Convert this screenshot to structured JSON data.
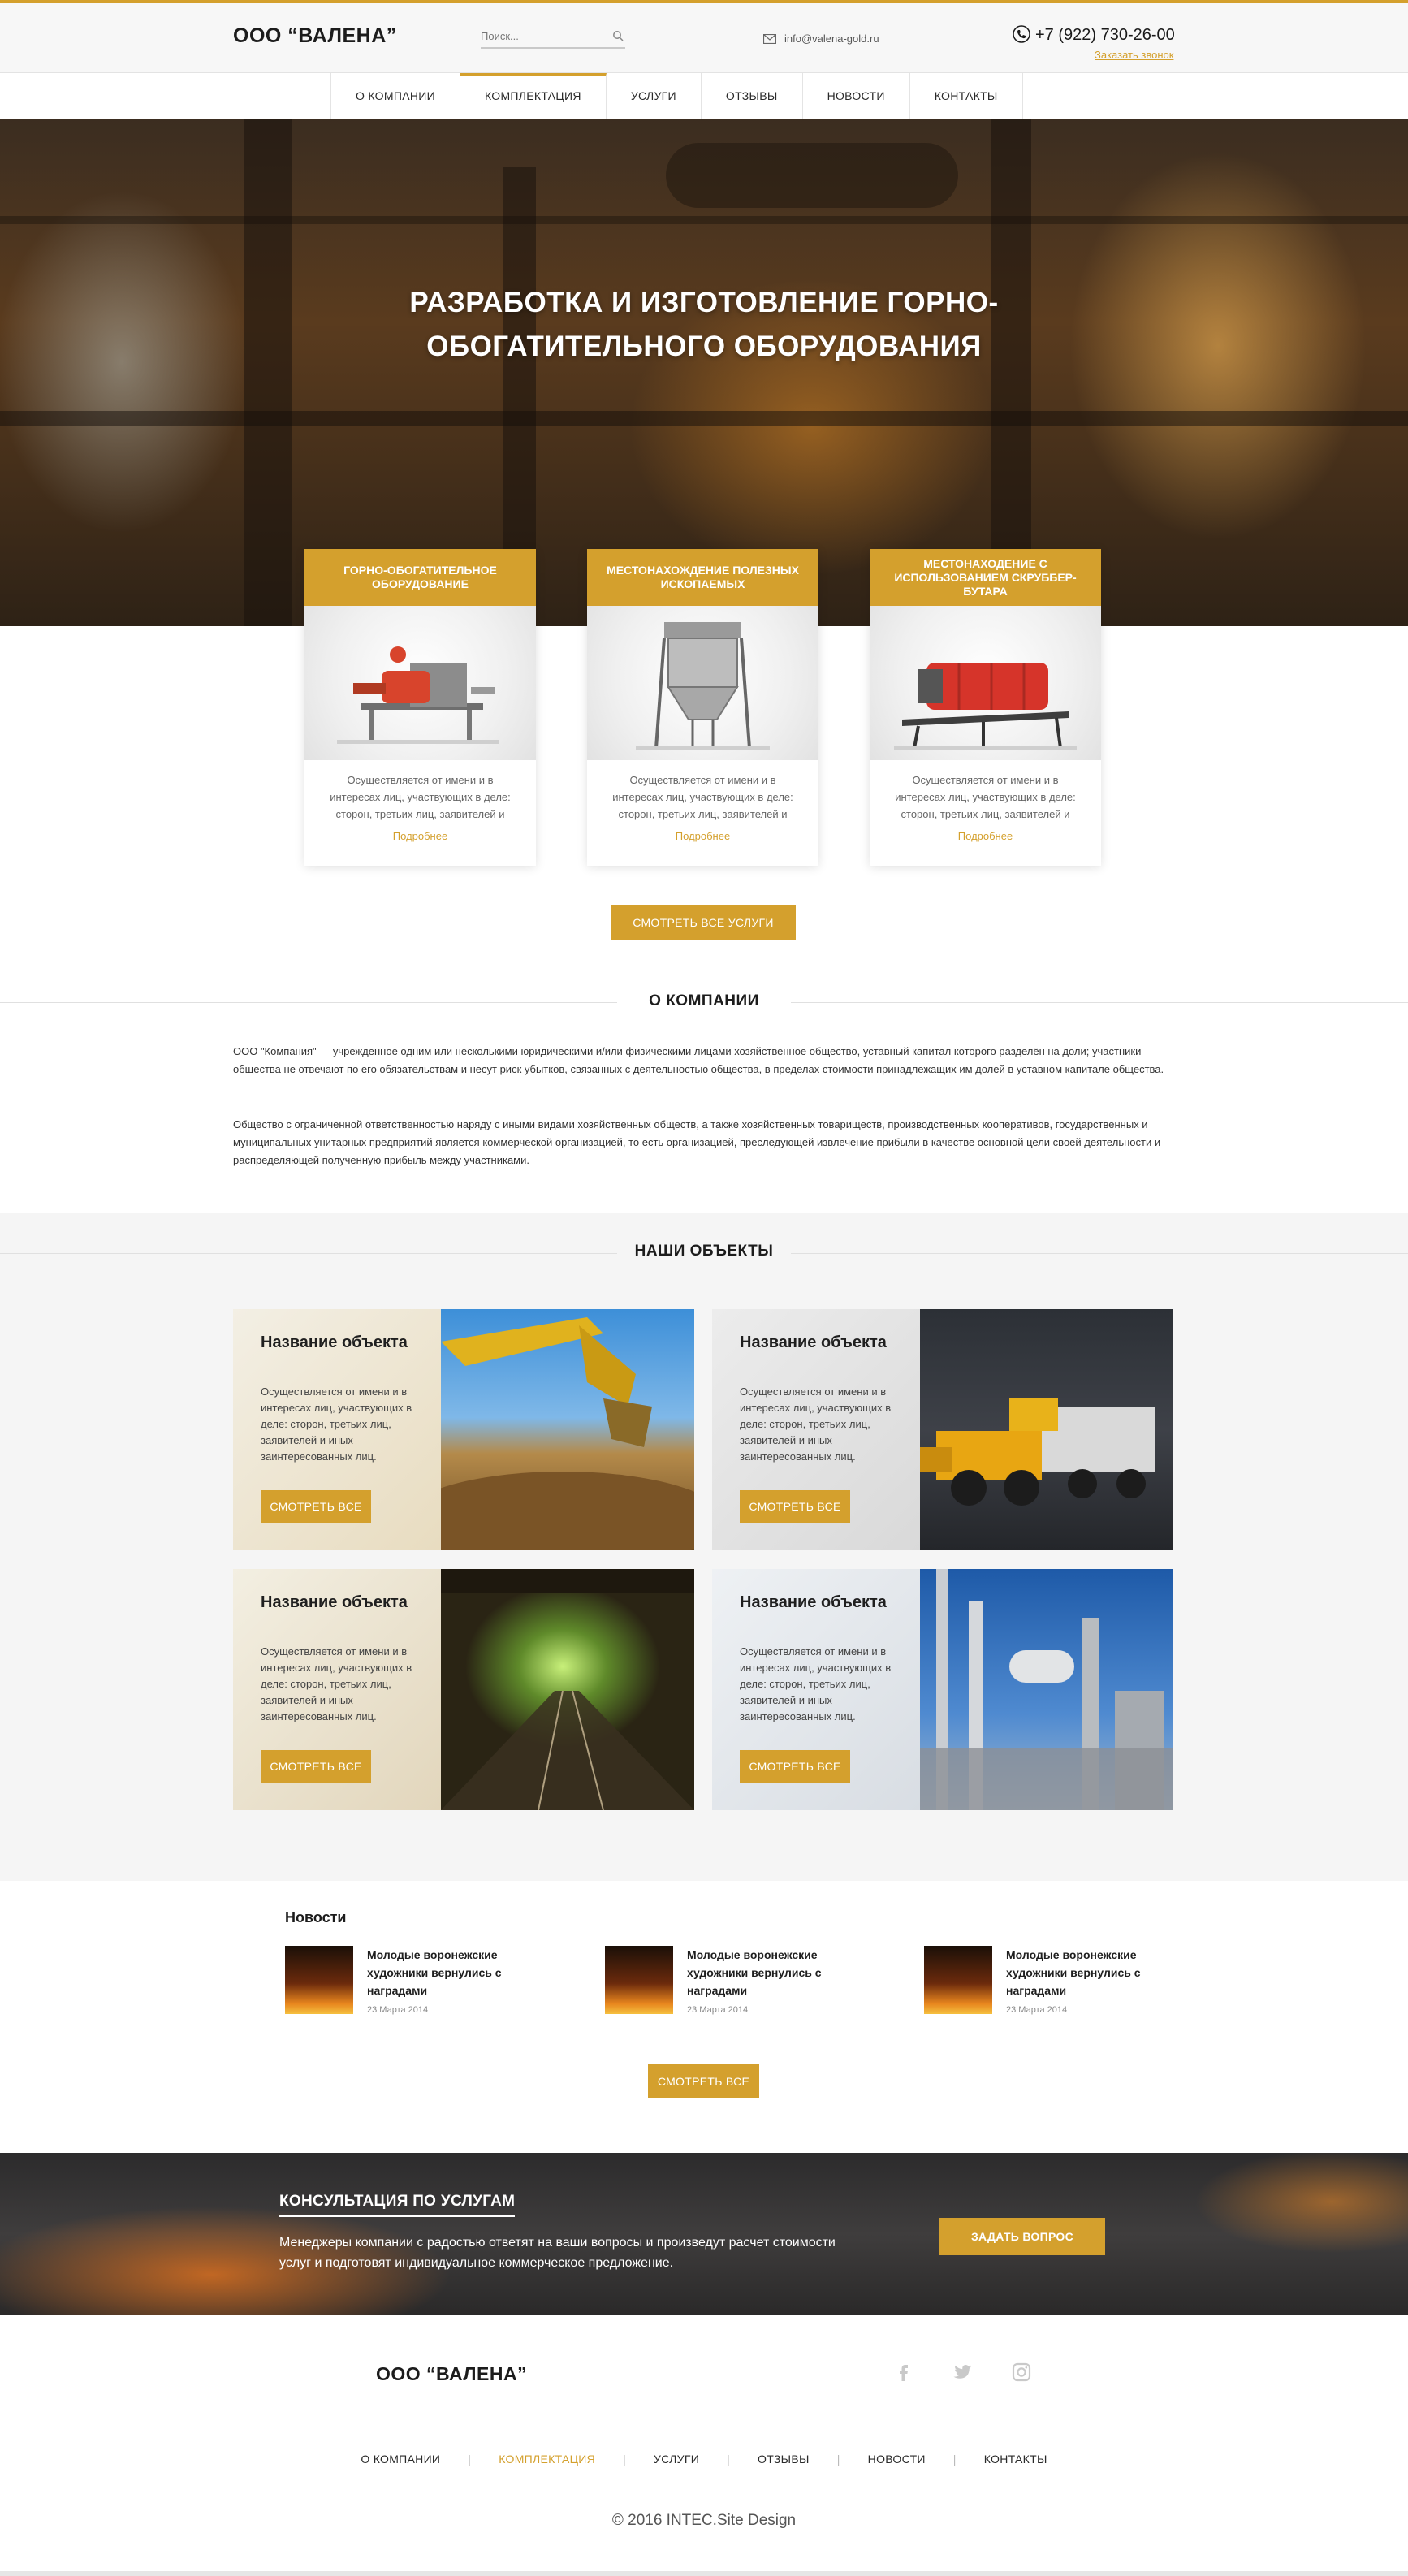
{
  "header": {
    "logo": "ООО “ВАЛЕНА”",
    "search_placeholder": "Поиск...",
    "email": "info@valena-gold.ru",
    "phone": "+7 (922) 730-26-00",
    "callback": "Заказать звонок"
  },
  "nav": {
    "items": [
      {
        "label": "О КОМПАНИИ"
      },
      {
        "label": "КОМПЛЕКТАЦИЯ"
      },
      {
        "label": "УСЛУГИ"
      },
      {
        "label": "ОТЗЫВЫ"
      },
      {
        "label": "НОВОСТИ"
      },
      {
        "label": "КОНТАКТЫ"
      }
    ],
    "active": "КОМПЛЕКТАЦИЯ"
  },
  "hero": {
    "title": "РАЗРАБОТКА И ИЗГОТОВЛЕНИЕ ГОРНО-ОБОГАТИТЕЛЬНОГО ОБОРУДОВАНИЯ"
  },
  "services": [
    {
      "title": "ГОРНО-ОБОГАТИТЕЛЬНОЕ ОБОРУДОВАНИЕ",
      "text": "Осуществляется от имени и в интересах лиц, участвующих в деле: сторон, третьих лиц, заявителей и",
      "link": "Подробнее"
    },
    {
      "title": "МЕСТОНАХОЖДЕНИЕ ПОЛЕЗНЫХ ИСКОПАЕМЫХ",
      "text": "Осуществляется от имени и в интересах лиц, участвующих в деле: сторон, третьих лиц, заявителей и",
      "link": "Подробнее"
    },
    {
      "title": "МЕСТОНАХОДЕНИЕ С ИСПОЛЬЗОВАНИЕМ СКРУББЕР-БУТАРА",
      "text": "Осуществляется от имени и в интересах лиц, участвующих в деле: сторон, третьих лиц, заявителей и",
      "link": "Подробнее"
    }
  ],
  "all_services_button": "СМОТРЕТЬ ВСЕ УСЛУГИ",
  "about": {
    "title": "О КОМПАНИИ",
    "p1": "ООО \"Компания\" — учрежденное одним или несколькими юридическими и/или физическими лицами хозяйственное общество, уставный капитал которого разделён на доли; участники общества не отвечают по его обязательствам и несут риск убытков, связанных с деятельностью общества, в пределах стоимости принадлежащих им долей в уставном капитале общества.",
    "p2": "Общество с ограниченной ответственностью наряду с иными видами хозяйственных обществ, а также хозяйственных товариществ, производственных кооперативов, государственных и муниципальных унитарных предприятий является коммерческой организацией, то есть организацией, преследующей извлечение прибыли в качестве основной цели своей деятельности и распределяющей полученную прибыль между участниками."
  },
  "objects": {
    "title": "НАШИ ОБЪЕКТЫ",
    "items": [
      {
        "name": "Название объекта",
        "text": "Осуществляется от имени и в интересах лиц, участвующих в деле: сторон, третьих лиц, заявителей и иных заинтересованных лиц.",
        "button": "СМОТРЕТЬ ВСЕ"
      },
      {
        "name": "Название объекта",
        "text": "Осуществляется от имени и в интересах лиц, участвующих в деле: сторон, третьих лиц, заявителей и иных заинтересованных лиц.",
        "button": "СМОТРЕТЬ ВСЕ"
      },
      {
        "name": "Название объекта",
        "text": "Осуществляется от имени и в интересах лиц, участвующих в деле: сторон, третьих лиц, заявителей и иных заинтересованных лиц.",
        "button": "СМОТРЕТЬ ВСЕ"
      },
      {
        "name": "Название объекта",
        "text": "Осуществляется от имени и в интересах лиц, участвующих в деле: сторон, третьих лиц, заявителей и иных заинтересованных лиц.",
        "button": "СМОТРЕТЬ ВСЕ"
      }
    ]
  },
  "news": {
    "heading": "Новости",
    "items": [
      {
        "title": "Молодые воронежские художники вернулись с наградами",
        "date": "23 Марта 2014"
      },
      {
        "title": "Молодые воронежские художники вернулись с наградами",
        "date": "23 Марта 2014"
      },
      {
        "title": "Молодые воронежские художники вернулись с наградами",
        "date": "23 Марта 2014"
      }
    ],
    "all_button": "СМОТРЕТЬ ВСЕ"
  },
  "consultation": {
    "title": "КОНСУЛЬТАЦИЯ ПО УСЛУГАМ",
    "text": "Менеджеры компании с радостью ответят на ваши вопросы и произведут расчет стоимости услуг и подготовят индивидуальное коммерческое предложение.",
    "button": "ЗАДАТЬ ВОПРОС"
  },
  "footer": {
    "logo": "ООО “ВАЛЕНА”",
    "social": [
      "facebook-icon",
      "twitter-icon",
      "instagram-icon"
    ],
    "nav": [
      {
        "label": "О КОМПАНИИ"
      },
      {
        "label": "КОМПЛЕКТАЦИЯ"
      },
      {
        "label": "УСЛУГИ"
      },
      {
        "label": "ОТЗЫВЫ"
      },
      {
        "label": "НОВОСТИ"
      },
      {
        "label": "КОНТАКТЫ"
      }
    ],
    "copyright": "© 2016 INTEC.Site Design"
  },
  "colors": {
    "accent": "#d4a02d",
    "text": "#1c1c1c"
  }
}
